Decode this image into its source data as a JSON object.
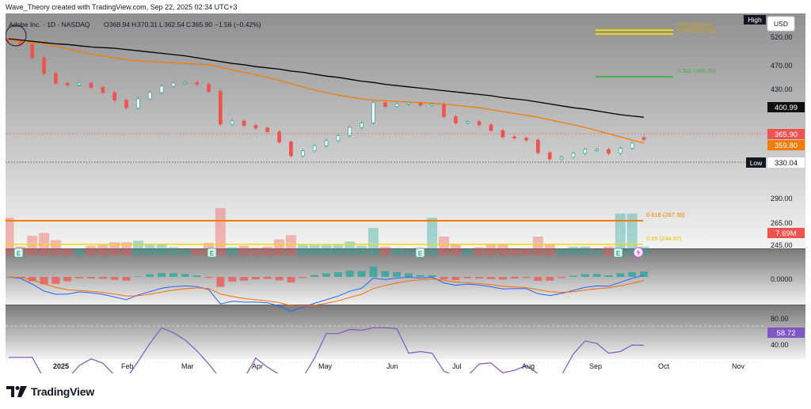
{
  "header": {
    "attribution": "Wave_Theory created with TradingView.com, Sep 22, 2025 02:34 UTC+3"
  },
  "ohlc_bar": {
    "symbol": "Adobe Inc. · 1D · NASDAQ",
    "o_label": "O",
    "o": "368.94",
    "h_label": "H",
    "h": "370.31",
    "l_label": "L",
    "l": "362.54",
    "c_label": "C",
    "c": "365.90",
    "change": "−1.56 (−0.42%)"
  },
  "price_scale": {
    "currency": "USD",
    "ticks": [
      "520.00",
      "470.00",
      "430.00",
      "290.00",
      "265.00",
      "245.00"
    ]
  },
  "badges": {
    "high": "High",
    "low": "Low",
    "ma200": "400.99",
    "last": "365.90",
    "ma50": "359.80",
    "low_value": "330.04",
    "volume": "7.69M",
    "macd_zero": "0.0000",
    "rsi_80": "80.00",
    "rsi": "58.72",
    "rsi_40": "40.00"
  },
  "fib_labels": {
    "f065_upper": "0.65 (532.09)",
    "f0618_upper": "0.618 (522.21)",
    "f0382": "0.382 (449.38)",
    "f0618_lower": "0.618 (267.35)",
    "f065_lower": "0.65 (244.97)"
  },
  "time_axis": [
    "2025",
    "Feb",
    "Mar",
    "Apr",
    "May",
    "Jun",
    "Jul",
    "Aug",
    "Sep",
    "Oct",
    "Nov"
  ],
  "earnings_marker": "E",
  "footer": {
    "brand": "TradingView"
  },
  "colors": {
    "up": "#26a69a",
    "down": "#ef5350",
    "ma50": "#f57c00",
    "ma200": "#000000",
    "fib_gold": "#f5d800",
    "fib_green": "#4caf50",
    "rsi": "#7e57c2",
    "macd": "#2962ff",
    "signal": "#ff6d00"
  },
  "chart_data": {
    "type": "line",
    "title": "Adobe Inc. · 1D · NASDAQ",
    "ylim": [
      300,
      545
    ],
    "x": [
      "2024-12-09",
      "2024-12-12",
      "2024-12-16",
      "2024-12-19",
      "2024-12-24",
      "2024-12-30",
      "2025-01-06",
      "2025-01-10",
      "2025-01-16",
      "2025-01-22",
      "2025-01-28",
      "2025-02-03",
      "2025-02-07",
      "2025-02-13",
      "2025-02-20",
      "2025-02-26",
      "2025-03-04",
      "2025-03-10",
      "2025-03-12",
      "2025-03-14",
      "2025-03-20",
      "2025-03-26",
      "2025-04-01",
      "2025-04-04",
      "2025-04-07",
      "2025-04-10",
      "2025-04-16",
      "2025-04-23",
      "2025-04-29",
      "2025-05-05",
      "2025-05-12",
      "2025-05-16",
      "2025-05-22",
      "2025-05-28",
      "2025-06-02",
      "2025-06-06",
      "2025-06-12",
      "2025-06-16",
      "2025-06-20",
      "2025-06-27",
      "2025-07-03",
      "2025-07-10",
      "2025-07-17",
      "2025-07-24",
      "2025-07-31",
      "2025-08-06",
      "2025-08-12",
      "2025-08-18",
      "2025-08-22",
      "2025-08-28",
      "2025-09-04",
      "2025-09-10",
      "2025-09-12",
      "2025-09-16",
      "2025-09-19"
    ],
    "series": [
      {
        "values": [
          522,
          516,
          495,
          470,
          455,
          452,
          455,
          448,
          440,
          428,
          416,
          430,
          440,
          450,
          455,
          456,
          453,
          442,
          390,
          395,
          388,
          384,
          378,
          362,
          340,
          348,
          356,
          364,
          372,
          385,
          392,
          424,
          418,
          422,
          424,
          420,
          422,
          402,
          392,
          394,
          389,
          380,
          370,
          368,
          365,
          345,
          335,
          338,
          344,
          350,
          350,
          344,
          352,
          360,
          365.9
        ]
      }
    ],
    "sma50": [
      522,
      521,
      519,
      517,
      513,
      509,
      505,
      501,
      498,
      495,
      492,
      490,
      489,
      488,
      487,
      486,
      485,
      484,
      480,
      476,
      472,
      468,
      464,
      459,
      454,
      449,
      444,
      440,
      436,
      433,
      430,
      428,
      427,
      426,
      425,
      424,
      423,
      422,
      420,
      418,
      416,
      413,
      410,
      407,
      404,
      401,
      397,
      393,
      389,
      385,
      380,
      375,
      370,
      365,
      360
    ],
    "sma200": [
      525,
      523,
      521,
      519,
      517,
      516,
      514,
      512,
      511,
      510,
      508,
      506,
      504,
      502,
      500,
      498,
      495,
      492,
      489,
      486,
      484,
      481,
      479,
      477,
      474,
      472,
      469,
      466,
      464,
      461,
      458,
      456,
      453,
      451,
      449,
      447,
      445,
      443,
      441,
      439,
      437,
      435,
      432,
      430,
      428,
      425,
      422,
      419,
      416,
      414,
      411,
      408,
      405,
      403,
      401
    ],
    "fib_levels": [
      {
        "ratio": 0.65,
        "price": 532.09
      },
      {
        "ratio": 0.618,
        "price": 522.21
      },
      {
        "ratio": 0.382,
        "price": 449.38
      },
      {
        "ratio": 0.618,
        "price": 267.35
      },
      {
        "ratio": 0.65,
        "price": 244.97
      }
    ],
    "last": {
      "open": 368.94,
      "high": 370.31,
      "low": 362.54,
      "close": 365.9,
      "change": -1.56,
      "change_pct": -0.42
    },
    "volume_last": "7.69M",
    "rsi_last": 58.72
  }
}
